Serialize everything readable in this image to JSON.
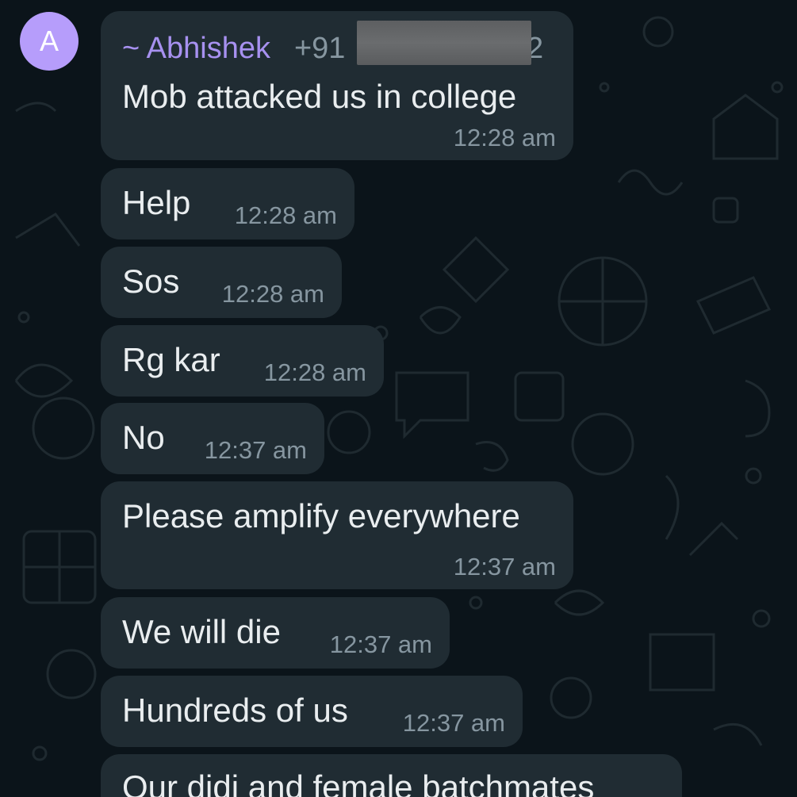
{
  "theme": {
    "background": "#0b141a",
    "bubble": "#202c33",
    "sender_color": "#a791f0",
    "avatar_color": "#b69dfb",
    "time_color": "#8696a0"
  },
  "avatar": {
    "letter": "A"
  },
  "sender": {
    "name": "~ Abhishek",
    "phone_prefix": "+91",
    "phone_suffix": "2",
    "phone_redacted": true
  },
  "messages": [
    {
      "text": "Mob attacked us in college",
      "time": "12:28 am"
    },
    {
      "text": "Help",
      "time": "12:28 am"
    },
    {
      "text": "Sos",
      "time": "12:28 am"
    },
    {
      "text": "Rg kar",
      "time": "12:28 am"
    },
    {
      "text": "No",
      "time": "12:37 am"
    },
    {
      "text": "Please amplify everywhere",
      "time": "12:37 am"
    },
    {
      "text": "We will die",
      "time": "12:37 am"
    },
    {
      "text": "Hundreds of us",
      "time": "12:37 am"
    },
    {
      "text": "Our didi and female batchmates"
    }
  ]
}
